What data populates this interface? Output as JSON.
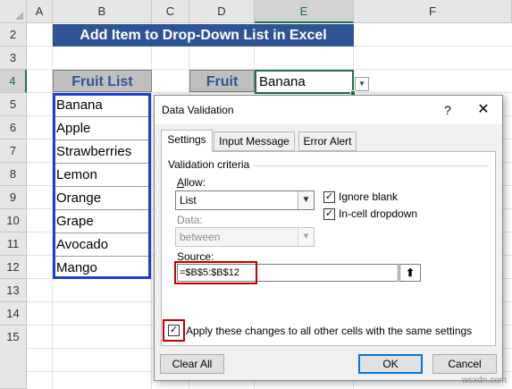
{
  "sheet": {
    "columns": [
      "A",
      "B",
      "C",
      "D",
      "E",
      "F"
    ],
    "active_column": "E",
    "rows": [
      "2",
      "3",
      "4",
      "5",
      "6",
      "7",
      "8",
      "9",
      "10",
      "11",
      "12",
      "13",
      "14",
      "15"
    ],
    "active_row": "4",
    "title": "Add Item to Drop-Down List in Excel",
    "fruit_list_header": "Fruit List",
    "fruit_header": "Fruit",
    "fruit_value": "Banana",
    "fruit_list": [
      "Banana",
      "Apple",
      "Strawberries",
      "Lemon",
      "Orange",
      "Grape",
      "Avocado",
      "Mango"
    ]
  },
  "dialog": {
    "title": "Data Validation",
    "help": "?",
    "close": "✕",
    "tabs": [
      "Settings",
      "Input Message",
      "Error Alert"
    ],
    "selected_tab": "Settings",
    "validation_criteria": "Validation criteria",
    "allow_label": "Allow:",
    "allow_value": "List",
    "ignore_blank_label": "Ignore blank",
    "ignore_blank_checked": true,
    "incell_dropdown_label": "In-cell dropdown",
    "incell_dropdown_checked": true,
    "data_label": "Data:",
    "data_value": "between",
    "source_label": "Source:",
    "source_value": "=$B$5:$B$12",
    "apply_all_label": "Apply these changes to all other cells with the same settings",
    "apply_all_checked": true,
    "clear_all_label": "Clear All",
    "ok_label": "OK",
    "cancel_label": "Cancel"
  },
  "watermark": "wsxdn.com",
  "colors": {
    "banner": "#2f5496",
    "header_cell": "#bfbfbf",
    "list_border": "#1f3fd0",
    "highlight_red": "#c00000",
    "excel_green": "#217346"
  }
}
